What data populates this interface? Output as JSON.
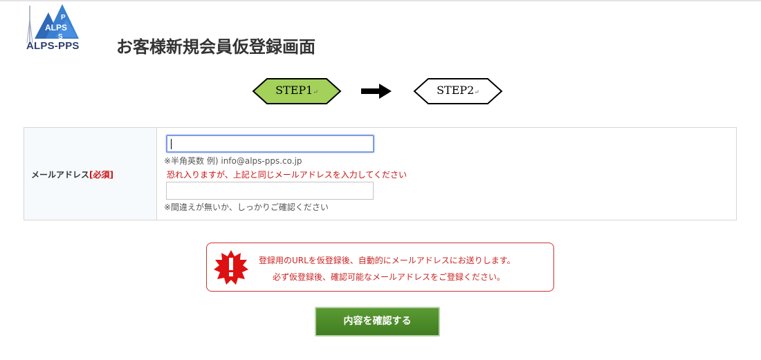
{
  "header": {
    "logo_text": "ALPS-PPS",
    "logo_mark_letters": [
      "P",
      "ALPS",
      "S"
    ],
    "title": "お客様新規会員仮登録画面"
  },
  "steps": {
    "step1_label": "STEP1",
    "step2_label": "STEP2",
    "return_mark": "↵",
    "active_step": 1,
    "active_color": "#a3d15a",
    "arrow_icon": "right-arrow-icon"
  },
  "form": {
    "email_label": "メールアドレス",
    "required_mark": "[必須]",
    "email_value": "",
    "email_hint": "※半角英数 例) info@alps-pps.co.jp",
    "confirm_note": "恐れ入りますが、上記と同じメールアドレスを入力してください",
    "confirm_value": "",
    "confirm_hint": "※間違えが無いか、しっかりご確認ください"
  },
  "notice": {
    "icon": "exclamation-burst-icon",
    "line1": "登録用のURLを仮登録後、自動的にメールアドレスにお送りします。",
    "line2": "必ず仮登録後、確認可能なメールアドレスをご登録ください。",
    "color": "#cc2222"
  },
  "submit": {
    "label": "内容を確認する",
    "color": "#4e8a2a"
  }
}
